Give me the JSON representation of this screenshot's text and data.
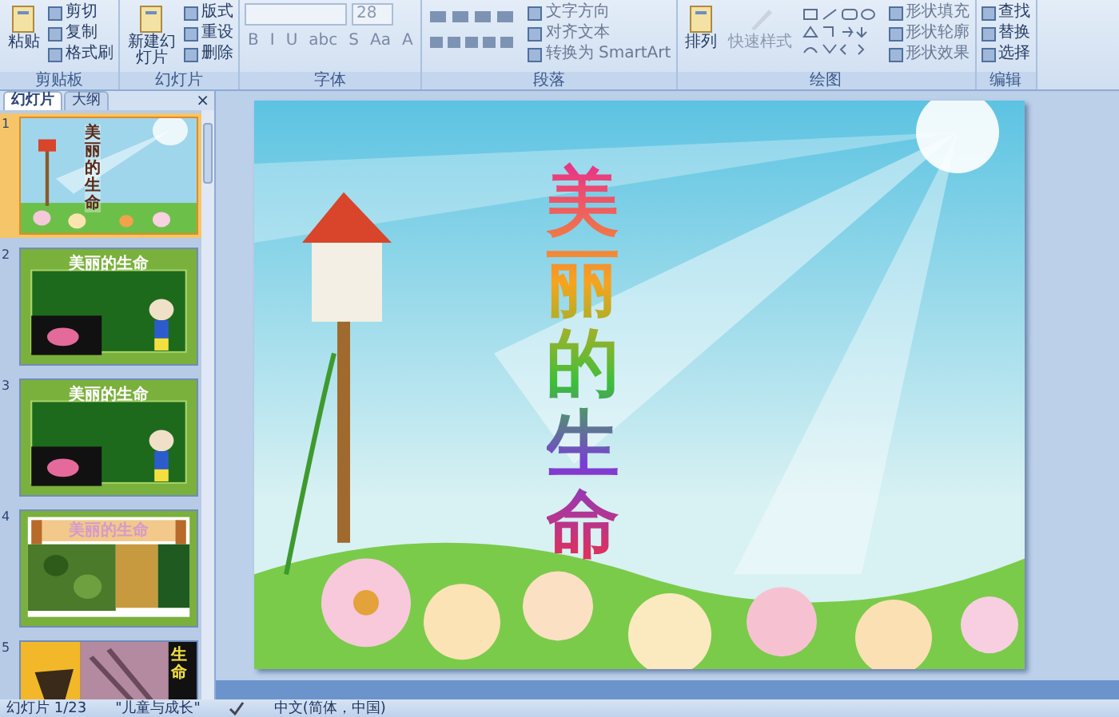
{
  "ribbon": {
    "groups": [
      {
        "label": "剪贴板",
        "big": {
          "label": "粘贴"
        },
        "small": [
          "剪切",
          "复制",
          "格式刷"
        ]
      },
      {
        "label": "幻灯片",
        "big": {
          "label": "新建幻灯片"
        },
        "small": [
          "版式",
          "重设",
          "删除"
        ]
      },
      {
        "label": "字体",
        "font_size": "28",
        "format_buttons": [
          "B",
          "I",
          "U",
          "abc",
          "S",
          "Aa",
          "A"
        ]
      },
      {
        "label": "段落",
        "small": [
          "文字方向",
          "对齐文本",
          "转换为 SmartArt"
        ]
      },
      {
        "label": "绘图",
        "big": {
          "label": "排列"
        },
        "big2": {
          "label": "快速样式"
        },
        "small": [
          "形状填充",
          "形状轮廓",
          "形状效果"
        ]
      },
      {
        "label": "编辑",
        "small": [
          "查找",
          "替换",
          "选择"
        ]
      }
    ]
  },
  "panel": {
    "tabs": [
      {
        "label": "幻灯片",
        "selected": true
      },
      {
        "label": "大纲",
        "selected": false
      }
    ],
    "close": "×",
    "thumbnails": [
      {
        "number": "1",
        "kind": "sky",
        "title": "美丽的生命",
        "selected": true
      },
      {
        "number": "2",
        "kind": "green",
        "title": "美丽的生命",
        "selected": false
      },
      {
        "number": "3",
        "kind": "green",
        "title": "美丽的生命",
        "selected": false
      },
      {
        "number": "4",
        "kind": "frame",
        "title": "美丽的生命",
        "selected": false
      },
      {
        "number": "5",
        "kind": "dark",
        "title": "生命",
        "selected": false
      }
    ]
  },
  "slide": {
    "title": "美丽的生命"
  },
  "status_bar": {
    "slide": "幻灯片 1/23",
    "theme": "\"儿童与成长\"",
    "language": "中文(简体，中国)"
  }
}
